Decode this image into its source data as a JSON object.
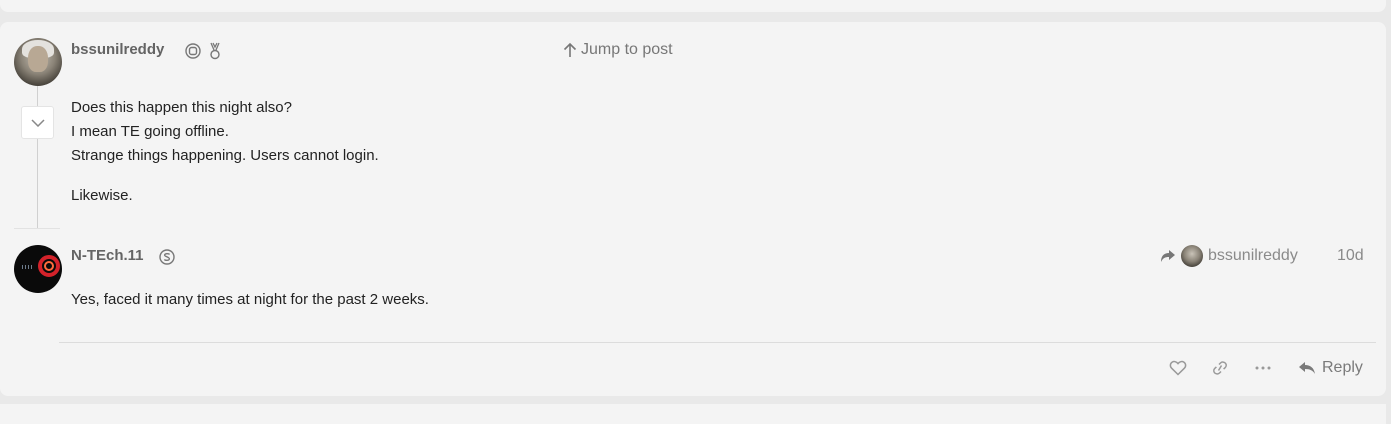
{
  "colors": {
    "card_bg": "#f4f4f4",
    "page_bg": "#e9e9e9",
    "muted": "#8a8a8a",
    "avatar_ring": "#d3222a"
  },
  "post_1": {
    "username": "bssunilreddy",
    "badges": [
      "target-badge-icon",
      "medal-badge-icon"
    ],
    "jump_label": "Jump to post",
    "lines": [
      "Does this happen this night also?",
      "I mean TE going offline.",
      "Strange things happening. Users cannot login."
    ],
    "extra_line": "Likewise."
  },
  "post_2": {
    "username": "N-TEch.11",
    "badge": "s-badge-icon",
    "reply_to_user": "bssunilreddy",
    "date": "10d",
    "body": "Yes, faced it many times at night for the past 2 weeks."
  },
  "actions": {
    "like_icon": "heart-icon",
    "link_icon": "link-icon",
    "more_icon": "ellipsis-icon",
    "reply_label": "Reply"
  }
}
